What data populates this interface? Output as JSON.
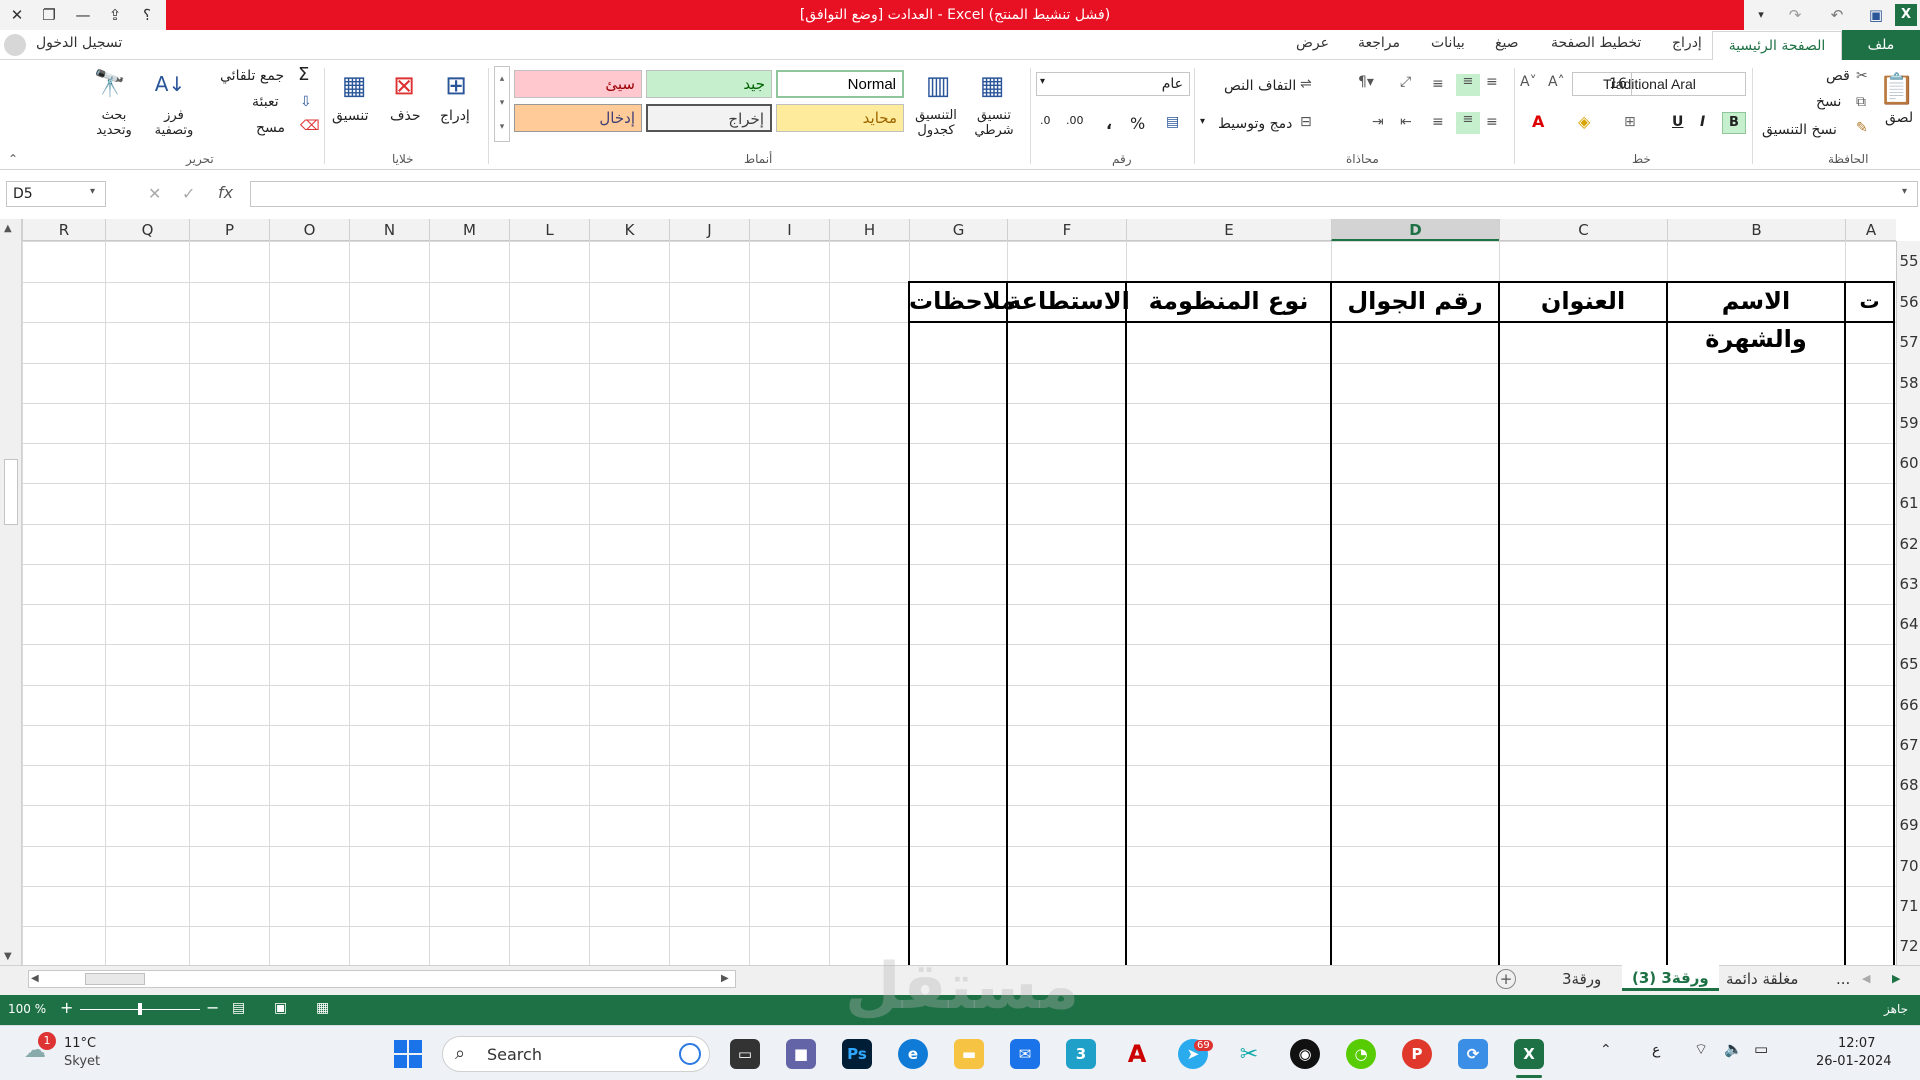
{
  "titlebar": {
    "title": "العدادت  [وضع التوافق] - Excel (فشل تنشيط المنتج)",
    "help": "؟",
    "app_icon": "X"
  },
  "menu": {
    "file": "ملف",
    "home": "الصفحة الرئيسية",
    "insert": "إدراج",
    "page_layout": "تخطيط الصفحة",
    "formulas": "صيغ",
    "data": "بيانات",
    "review": "مراجعة",
    "view": "عرض",
    "sign_in": "تسجيل الدخول"
  },
  "ribbon": {
    "clipboard": {
      "group": "الحافظة",
      "paste": "لصق",
      "cut": "قص",
      "copy": "نسخ",
      "format_painter": "نسخ التنسيق"
    },
    "font": {
      "group": "خط",
      "font_name": "Traditional Aral",
      "font_size": "16",
      "bold": "B",
      "italic": "I",
      "underline": "U"
    },
    "alignment": {
      "group": "محاذاة",
      "wrap_text": "التفاف النص",
      "merge": "دمج وتوسيط"
    },
    "number": {
      "group": "رقم",
      "format": "عام",
      "percent": "%",
      "comma": "،",
      "inc_decimal": ".00",
      "dec_decimal": ".0"
    },
    "styles": {
      "group": "أنماط",
      "conditional": "تنسيق شرطي",
      "format_table": "التنسيق كجدول",
      "cells": [
        {
          "label": "Normal",
          "bg": "#ffffff",
          "fg": "#000000"
        },
        {
          "label": "جيد",
          "bg": "#c6efce",
          "fg": "#006100"
        },
        {
          "label": "سيئ",
          "bg": "#ffc7ce",
          "fg": "#9c0006"
        },
        {
          "label": "محايد",
          "bg": "#ffeb9c",
          "fg": "#9c6500"
        },
        {
          "label": "إخراج",
          "bg": "#f2f2f2",
          "fg": "#3f3f3f"
        },
        {
          "label": "إدخال",
          "bg": "#ffcc99",
          "fg": "#3f3f76"
        }
      ]
    },
    "cells_grp": {
      "group": "خلايا",
      "insert": "إدراج",
      "delete": "حذف",
      "format": "تنسيق"
    },
    "editing": {
      "group": "تحرير",
      "autosum": "جمع تلقائي",
      "fill": "تعبئة",
      "clear": "مسح",
      "sort": "فرز وتصفية",
      "find": "بحث وتحديد"
    }
  },
  "formula_bar": {
    "name_box": "D5",
    "fx": "fx",
    "value": ""
  },
  "columns": [
    "A",
    "B",
    "C",
    "D",
    "E",
    "F",
    "G",
    "H",
    "I",
    "J",
    "K",
    "L",
    "M",
    "N",
    "O",
    "P",
    "Q",
    "R"
  ],
  "rows": [
    "55",
    "56",
    "57",
    "58",
    "59",
    "60",
    "61",
    "62",
    "63",
    "64",
    "65",
    "66",
    "67",
    "68",
    "69",
    "70",
    "71",
    "72"
  ],
  "table_headers": [
    "ت",
    "الاسم والشهرة",
    "العنوان",
    "رقم الجوال",
    "نوع المنظومة",
    "الاستطاعة",
    "ملاحظات"
  ],
  "sheets": {
    "more": "...",
    "tabs": [
      "مغلقة دائمة",
      "ورقة3 (3)",
      "ورقة3"
    ],
    "active": "ورقة3 (3)"
  },
  "status": {
    "ready": "جاهز",
    "zoom": "100 %"
  },
  "taskbar": {
    "weather_temp": "11°C",
    "weather_desc": "Skyet",
    "weather_badge": "1",
    "search": "Search",
    "time": "12:07",
    "date": "26-01-2024",
    "lang": "ع",
    "telegram_badge": "69"
  },
  "watermark": "مستقل",
  "colors": {
    "excel_green": "#1e7145",
    "title_red": "#e81123"
  }
}
